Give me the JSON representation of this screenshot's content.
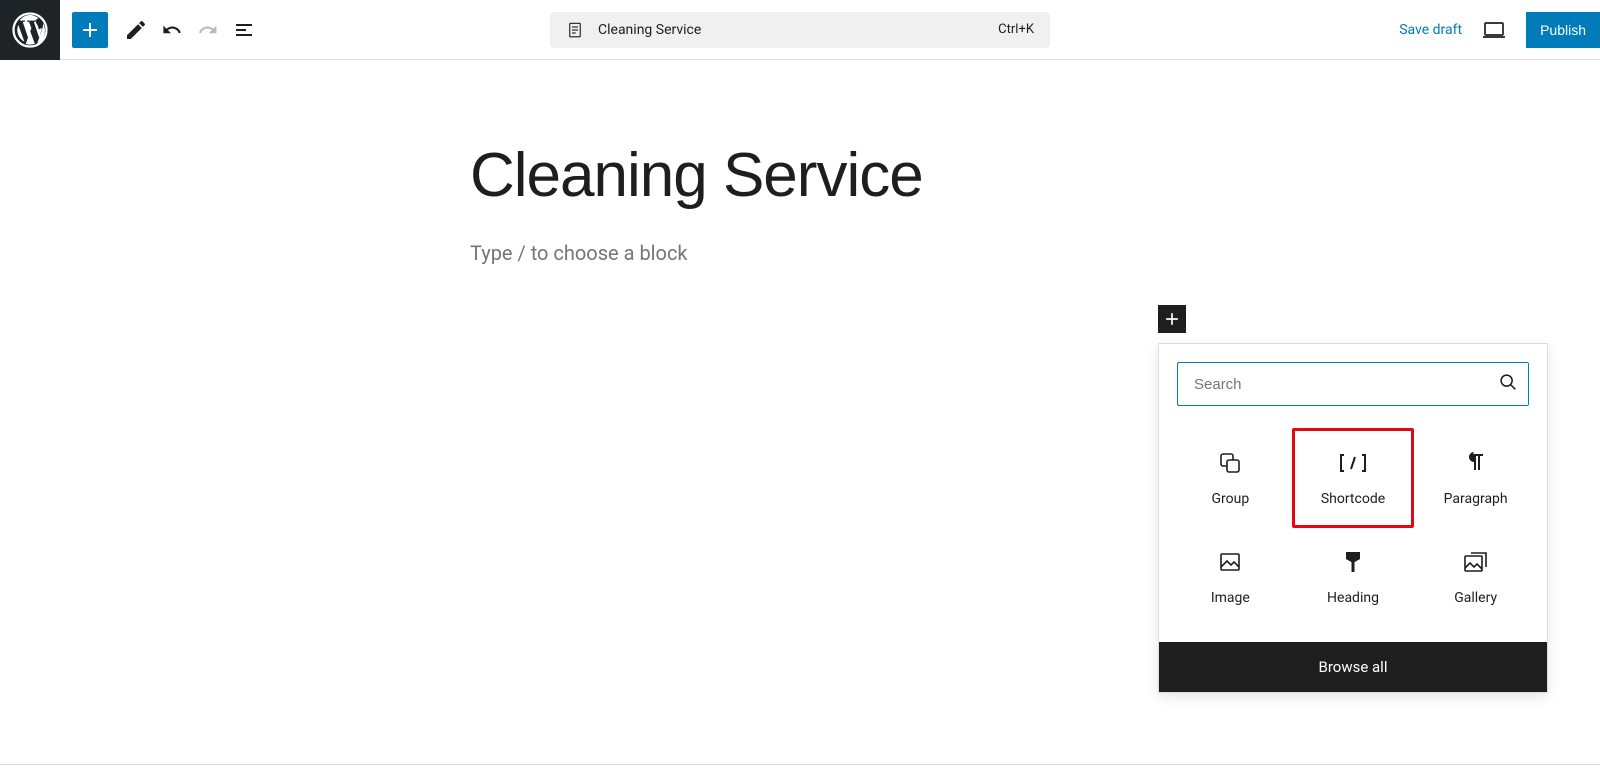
{
  "header": {
    "doc_title": "Cleaning Service",
    "shortcut": "Ctrl+K",
    "save_draft": "Save draft",
    "publish": "Publish"
  },
  "editor": {
    "title": "Cleaning Service",
    "placeholder": "Type / to choose a block"
  },
  "inserter": {
    "search_placeholder": "Search",
    "blocks": [
      {
        "label": "Group"
      },
      {
        "label": "Shortcode"
      },
      {
        "label": "Paragraph"
      },
      {
        "label": "Image"
      },
      {
        "label": "Heading"
      },
      {
        "label": "Gallery"
      }
    ],
    "browse_all": "Browse all"
  }
}
